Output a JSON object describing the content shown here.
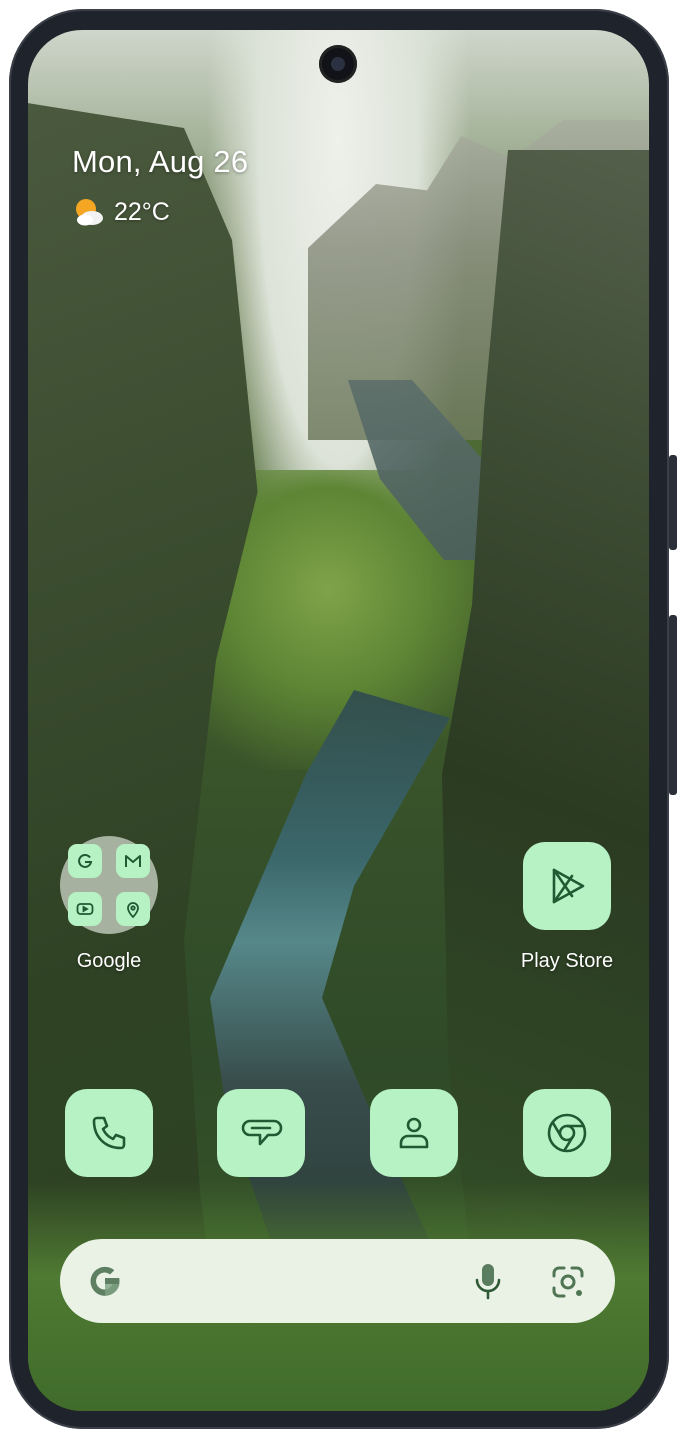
{
  "status": {
    "date": "Mon, Aug 26",
    "weather_icon": "partly-cloudy-sun-icon",
    "temperature": "22°C"
  },
  "home": {
    "folder": {
      "label": "Google",
      "apps": [
        "google-icon",
        "gmail-icon",
        "youtube-icon",
        "maps-icon"
      ]
    },
    "apps": [
      {
        "label": "Play Store",
        "icon": "play-store-icon"
      }
    ],
    "dock": [
      {
        "icon": "phone-icon"
      },
      {
        "icon": "messages-icon"
      },
      {
        "icon": "contacts-icon"
      },
      {
        "icon": "chrome-icon"
      }
    ]
  },
  "search_bar": {
    "icon_left": "google-g-icon",
    "icon_mic": "mic-icon",
    "icon_lens": "lens-icon"
  },
  "colors": {
    "icon_tile": "#b6f2c3",
    "icon_stroke": "#1f5a32",
    "search_bg": "#eaf2e6",
    "frame": "#1f232b"
  }
}
